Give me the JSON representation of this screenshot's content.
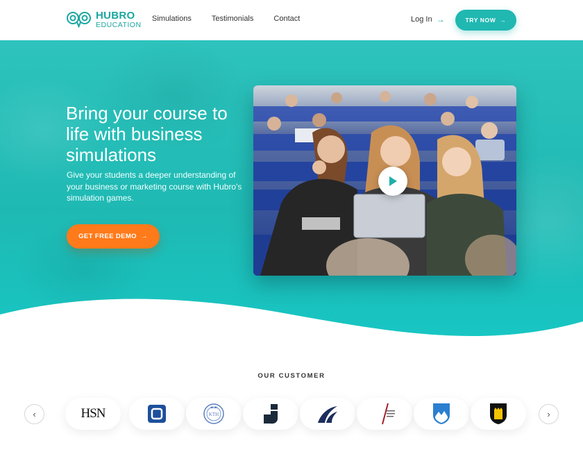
{
  "nav": {
    "logo_line1": "HUBRO",
    "logo_line2": "EDUCATION",
    "links": [
      "Simulations",
      "Testimonials",
      "Contact"
    ],
    "login_label": "Log In",
    "try_now_label": "TRY NOW",
    "accent": "#20b8b1"
  },
  "hero": {
    "headline": "Bring your course to life with business simulations",
    "subtext": "Give your students a deeper understanding of your business or marketing course with Hubro's simulation games.",
    "demo_button_label": "GET FREE DEMO",
    "demo_button_color": "#ff7a1a",
    "video_play_icon": "play-icon"
  },
  "customers": {
    "title": "OUR CUSTOMER",
    "logos": [
      {
        "name": "HSN",
        "text": "HSN"
      },
      {
        "name": "blue-square-logo"
      },
      {
        "name": "KTH",
        "text": "KTH"
      },
      {
        "name": "j-logo"
      },
      {
        "name": "wave-logo"
      },
      {
        "name": "slash-logo"
      },
      {
        "name": "shield-blue-logo"
      },
      {
        "name": "shield-black-logo"
      }
    ],
    "prev_icon": "chevron-left-icon",
    "next_icon": "chevron-right-icon"
  }
}
